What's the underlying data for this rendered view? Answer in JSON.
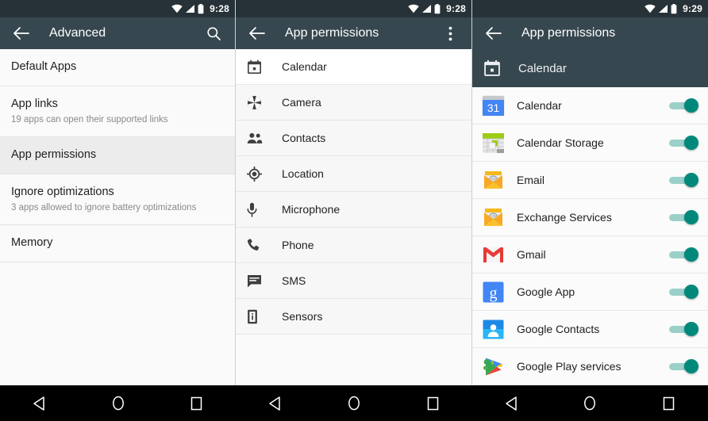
{
  "panels": [
    {
      "statusbar": {
        "time": "9:28",
        "icons": [
          "wifi-icon",
          "signal-icon",
          "battery-icon"
        ]
      },
      "toolbar": {
        "back": "back-arrow-icon",
        "title": "Advanced",
        "action": "search-icon"
      },
      "items": [
        {
          "title": "Default Apps",
          "subtitle": "",
          "selected": false
        },
        {
          "title": "App links",
          "subtitle": "19 apps can open their supported links",
          "selected": false
        },
        {
          "title": "App permissions",
          "subtitle": "",
          "selected": true
        },
        {
          "title": "Ignore optimizations",
          "subtitle": "3 apps allowed to ignore battery optimizations",
          "selected": false
        },
        {
          "title": "Memory",
          "subtitle": "",
          "selected": false
        }
      ]
    },
    {
      "statusbar": {
        "time": "9:28",
        "icons": [
          "wifi-icon",
          "signal-icon",
          "battery-icon"
        ]
      },
      "toolbar": {
        "back": "back-arrow-icon",
        "title": "App permissions",
        "action": "overflow-menu-icon"
      },
      "items": [
        {
          "label": "Calendar",
          "icon": "calendar-icon",
          "selected": true
        },
        {
          "label": "Camera",
          "icon": "camera-icon",
          "selected": false
        },
        {
          "label": "Contacts",
          "icon": "contacts-icon",
          "selected": false
        },
        {
          "label": "Location",
          "icon": "location-icon",
          "selected": false
        },
        {
          "label": "Microphone",
          "icon": "microphone-icon",
          "selected": false
        },
        {
          "label": "Phone",
          "icon": "phone-icon",
          "selected": false
        },
        {
          "label": "SMS",
          "icon": "sms-icon",
          "selected": false
        },
        {
          "label": "Sensors",
          "icon": "sensors-icon",
          "selected": false
        }
      ]
    },
    {
      "statusbar": {
        "time": "9:29",
        "icons": [
          "wifi-icon",
          "signal-icon",
          "battery-icon"
        ]
      },
      "toolbar": {
        "back": "back-arrow-icon",
        "title": "App permissions",
        "action": ""
      },
      "subheader": {
        "label": "Calendar",
        "icon": "calendar-icon"
      },
      "apps": [
        {
          "label": "Calendar",
          "icon": "google-calendar-icon",
          "enabled": true
        },
        {
          "label": "Calendar Storage",
          "icon": "calendar-storage-icon",
          "enabled": true
        },
        {
          "label": "Email",
          "icon": "email-icon",
          "enabled": true
        },
        {
          "label": "Exchange Services",
          "icon": "exchange-services-icon",
          "enabled": true
        },
        {
          "label": "Gmail",
          "icon": "gmail-icon",
          "enabled": true
        },
        {
          "label": "Google App",
          "icon": "google-app-icon",
          "enabled": true
        },
        {
          "label": "Google Contacts",
          "icon": "google-contacts-icon",
          "enabled": true
        },
        {
          "label": "Google Play services",
          "icon": "google-play-services-icon",
          "enabled": true
        }
      ]
    }
  ],
  "navbar": {
    "buttons": [
      {
        "name": "back-button",
        "icon": "triangle-back-icon"
      },
      {
        "name": "home-button",
        "icon": "circle-home-icon"
      },
      {
        "name": "recents-button",
        "icon": "square-recents-icon"
      }
    ]
  },
  "colors": {
    "statusbar": "#263238",
    "toolbar": "#37474f",
    "accent_toggle": "#00897b",
    "toggle_track": "#9bd0ca",
    "list_bg": "#fafafa",
    "selected_row": "#ececec",
    "navbar": "#000000"
  }
}
